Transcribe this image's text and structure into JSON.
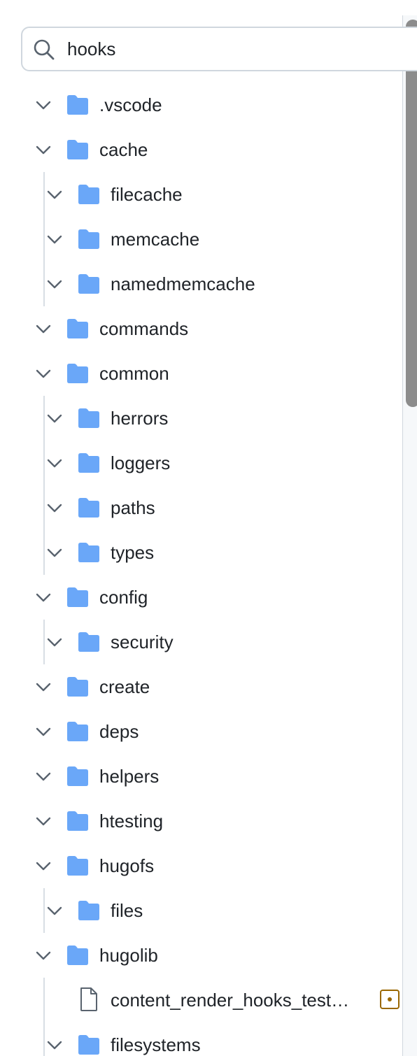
{
  "search": {
    "value": "hooks",
    "icon": "search-icon"
  },
  "colors": {
    "folder": "#6aa7f8",
    "chevron": "#59636e",
    "text": "#1f2328",
    "modified_badge": "#9a6700"
  },
  "tree": [
    {
      "type": "folder",
      "depth": 0,
      "name": ".vscode",
      "expanded": true
    },
    {
      "type": "folder",
      "depth": 0,
      "name": "cache",
      "expanded": true
    },
    {
      "type": "folder",
      "depth": 1,
      "name": "filecache",
      "expanded": true
    },
    {
      "type": "folder",
      "depth": 1,
      "name": "memcache",
      "expanded": true
    },
    {
      "type": "folder",
      "depth": 1,
      "name": "namedmemcache",
      "expanded": true
    },
    {
      "type": "folder",
      "depth": 0,
      "name": "commands",
      "expanded": true
    },
    {
      "type": "folder",
      "depth": 0,
      "name": "common",
      "expanded": true
    },
    {
      "type": "folder",
      "depth": 1,
      "name": "herrors",
      "expanded": true
    },
    {
      "type": "folder",
      "depth": 1,
      "name": "loggers",
      "expanded": true
    },
    {
      "type": "folder",
      "depth": 1,
      "name": "paths",
      "expanded": true
    },
    {
      "type": "folder",
      "depth": 1,
      "name": "types",
      "expanded": true
    },
    {
      "type": "folder",
      "depth": 0,
      "name": "config",
      "expanded": true
    },
    {
      "type": "folder",
      "depth": 1,
      "name": "security",
      "expanded": true
    },
    {
      "type": "folder",
      "depth": 0,
      "name": "create",
      "expanded": true
    },
    {
      "type": "folder",
      "depth": 0,
      "name": "deps",
      "expanded": true
    },
    {
      "type": "folder",
      "depth": 0,
      "name": "helpers",
      "expanded": true
    },
    {
      "type": "folder",
      "depth": 0,
      "name": "htesting",
      "expanded": true
    },
    {
      "type": "folder",
      "depth": 0,
      "name": "hugofs",
      "expanded": true
    },
    {
      "type": "folder",
      "depth": 1,
      "name": "files",
      "expanded": true
    },
    {
      "type": "folder",
      "depth": 0,
      "name": "hugolib",
      "expanded": true
    },
    {
      "type": "file",
      "depth": 1,
      "name": "content_render_hooks_test…",
      "status": "modified"
    },
    {
      "type": "folder",
      "depth": 1,
      "name": "filesystems",
      "expanded": true
    }
  ]
}
